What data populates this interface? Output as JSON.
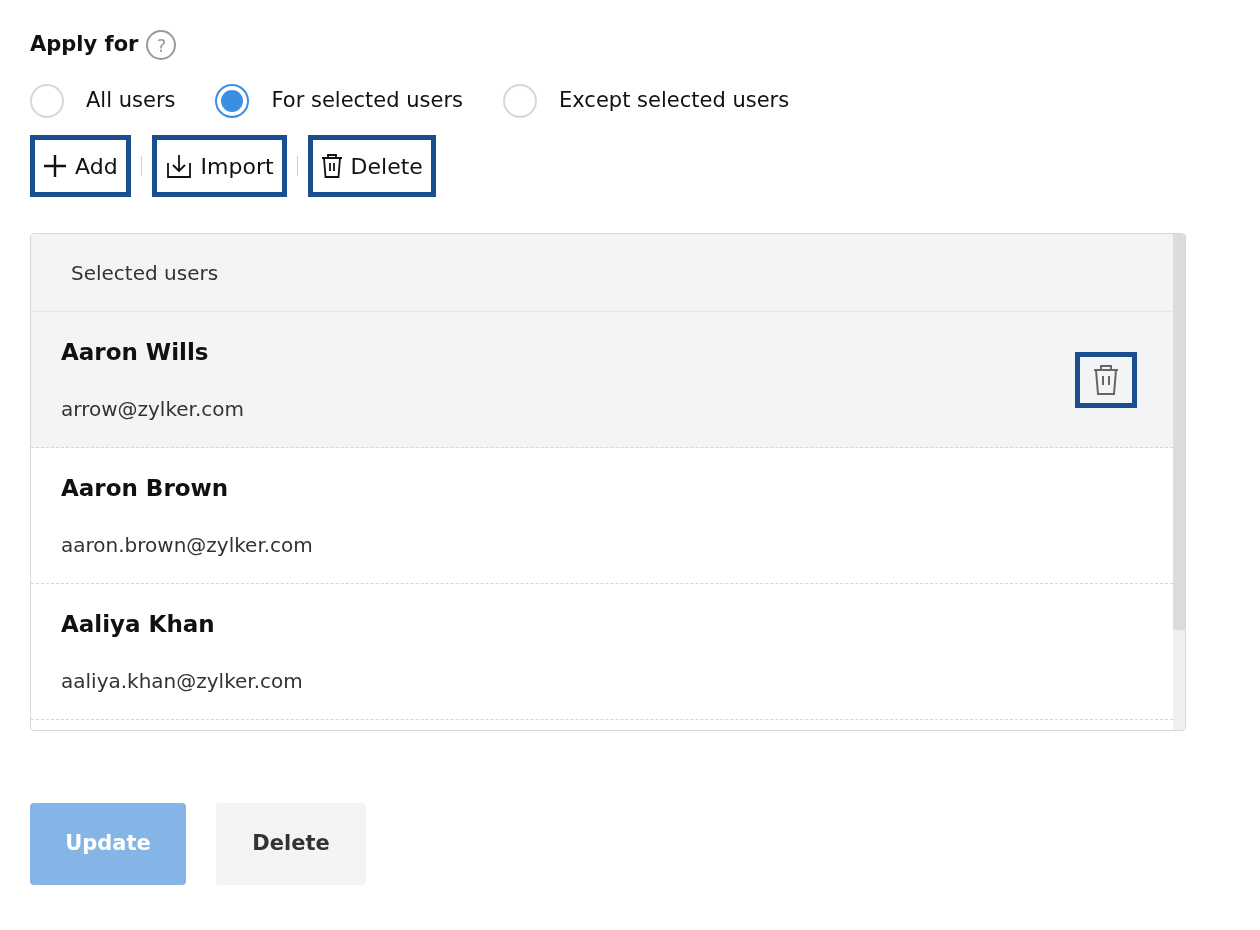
{
  "title": "Apply for",
  "help_icon": "?",
  "scope_options": [
    {
      "label": "All users",
      "selected": false
    },
    {
      "label": "For selected users",
      "selected": true
    },
    {
      "label": "Except selected users",
      "selected": false
    }
  ],
  "toolbar": [
    {
      "kind": "add",
      "label": "Add",
      "highlighted": true
    },
    {
      "kind": "import",
      "label": "Import",
      "highlighted": true
    },
    {
      "kind": "delete",
      "label": "Delete",
      "highlighted": true
    }
  ],
  "user_list": {
    "header": "Selected users",
    "rows": [
      {
        "name": "Aaron Wills",
        "email": "arrow@zylker.com",
        "hovered": true,
        "delete_button": {
          "highlighted": true
        }
      },
      {
        "name": "Aaron Brown",
        "email": "aaron.brown@zylker.com",
        "hovered": false
      },
      {
        "name": "Aaliya Khan",
        "email": "aaliya.khan@zylker.com",
        "hovered": false
      }
    ]
  },
  "actions": [
    {
      "kind": "primary",
      "label": "Update"
    },
    {
      "kind": "secondary",
      "label": "Delete"
    }
  ]
}
